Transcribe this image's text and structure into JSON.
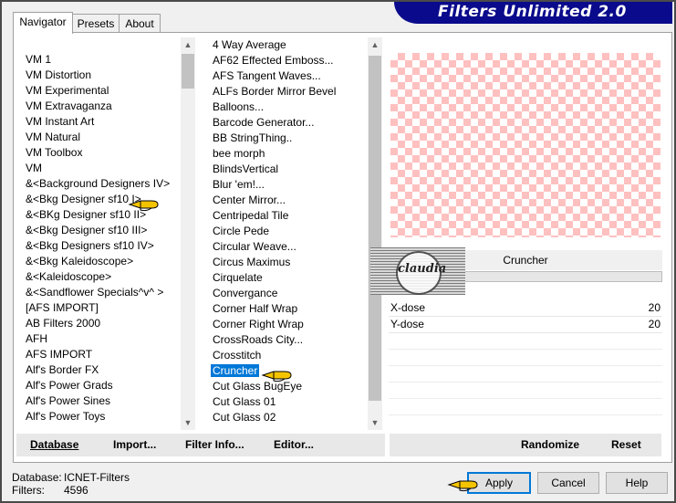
{
  "window": {
    "title": "Filters Unlimited 2.0"
  },
  "tabs": [
    {
      "label": "Navigator",
      "active": true
    },
    {
      "label": "Presets",
      "active": false
    },
    {
      "label": "About",
      "active": false
    }
  ],
  "categories": {
    "items": [
      "VM 1",
      "VM Distortion",
      "VM Experimental",
      "VM Extravaganza",
      "VM Instant Art",
      "VM Natural",
      "VM Toolbox",
      "VM",
      "&<Background Designers IV>",
      "&<Bkg Designer sf10 I>",
      "&<BKg Designer sf10 II>",
      "&<Bkg Designer sf10 III>",
      "&<Bkg Designers sf10 IV>",
      "&<Bkg Kaleidoscope>",
      "&<Kaleidoscope>",
      "&<Sandflower Specials^v^ >",
      "[AFS IMPORT]",
      "AB Filters 2000",
      "AFH",
      "AFS IMPORT",
      "Alf's Border FX",
      "Alf's Power Grads",
      "Alf's Power Sines",
      "Alf's Power Toys"
    ]
  },
  "filters": {
    "items": [
      "4 Way Average",
      "AF62 Effected Emboss...",
      "AFS Tangent Waves...",
      "ALFs Border Mirror Bevel",
      "Balloons...",
      "Barcode Generator...",
      "BB StringThing..",
      "bee morph",
      "BlindsVertical",
      "Blur 'em!...",
      "Center Mirror...",
      "Centripedal Tile",
      "Circle Pede",
      "Circular Weave...",
      "Circus Maximus",
      "Cirquelate",
      "Convergance",
      "Corner Half Wrap",
      "Corner Right Wrap",
      "CrossRoads City...",
      "Crosstitch",
      "Cruncher",
      "Cut Glass  BugEye",
      "Cut Glass 01",
      "Cut Glass 02"
    ],
    "selected": "Cruncher"
  },
  "filter_panel": {
    "name": "Cruncher",
    "params": [
      {
        "label": "X-dose",
        "value": "20"
      },
      {
        "label": "Y-dose",
        "value": "20"
      }
    ]
  },
  "watermark": {
    "text": "claudia"
  },
  "toolbar": {
    "database": "Database",
    "import": "Import...",
    "filter_info": "Filter Info...",
    "editor": "Editor...",
    "randomize": "Randomize",
    "reset": "Reset"
  },
  "buttons": {
    "apply": "Apply",
    "cancel": "Cancel",
    "help": "Help"
  },
  "status": {
    "database_label": "Database:",
    "database_value": "ICNET-Filters",
    "filters_label": "Filters:",
    "filters_value": "4596"
  },
  "colors": {
    "title_bg": "#0a0a8c",
    "selection": "#0078d7",
    "checker": "#ffc0c0",
    "pointer": "#f5c400"
  },
  "icons": {
    "scroll_up": "triangle-up",
    "scroll_down": "triangle-down",
    "pointer": "pointing-hand"
  }
}
